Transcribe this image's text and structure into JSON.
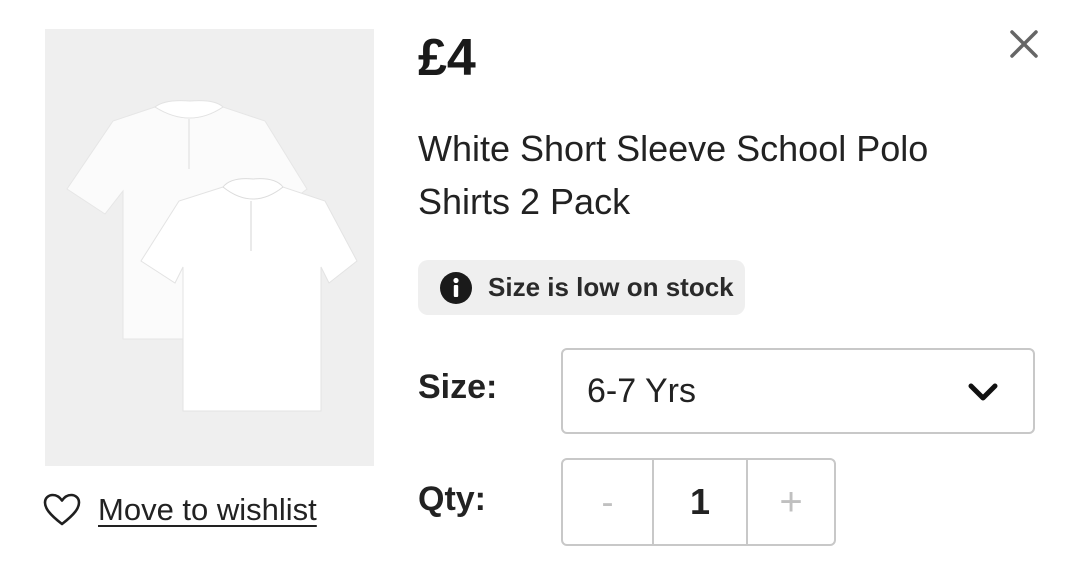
{
  "product": {
    "price": "£4",
    "title": "White Short Sleeve School Polo Shirts 2 Pack",
    "image_icon": "product-photo-polo-shirts"
  },
  "stock_notice": {
    "icon": "info-icon",
    "text": "Size is low on stock"
  },
  "size": {
    "label": "Size:",
    "selected": "6-7 Yrs",
    "icon": "chevron-down-icon"
  },
  "quantity": {
    "label": "Qty:",
    "decrement_label": "-",
    "value": "1",
    "increment_label": "+"
  },
  "wishlist": {
    "icon": "heart-icon",
    "label": "Move to wishlist"
  },
  "close": {
    "icon": "close-icon"
  },
  "colors": {
    "text": "#1f1f1f",
    "badge_bg": "#efefef",
    "border": "#c8c8c8",
    "muted": "#c0c0c0"
  }
}
